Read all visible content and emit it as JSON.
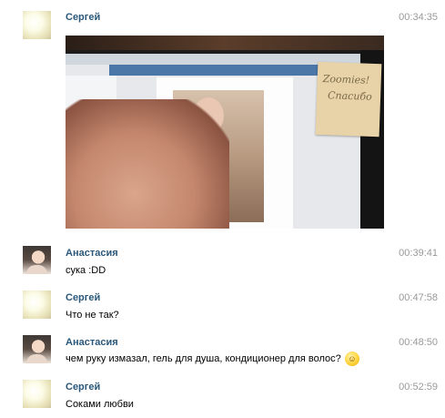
{
  "messages": [
    {
      "author": "Сергей",
      "time": "00:34:35",
      "text": "",
      "avatar": "sergey-avatar"
    },
    {
      "author": "Анастасия",
      "time": "00:39:41",
      "text": "сука :DD",
      "avatar": "anastasia-avatar"
    },
    {
      "author": "Сергей",
      "time": "00:47:58",
      "text": "Что не так?",
      "avatar": "sergey-avatar"
    },
    {
      "author": "Анастасия",
      "time": "00:48:50",
      "text": "чем руку измазал, гель для душа, кондиционер для волос?",
      "emoji": "laughing-emoji",
      "avatar": "anastasia-avatar"
    },
    {
      "author": "Сергей",
      "time": "00:52:59",
      "text": "Соками любви",
      "avatar": "sergey-avatar"
    }
  ],
  "attachment": {
    "note_line1": "Zoomies!",
    "note_line2": "Спасибо"
  },
  "colors": {
    "author": "#2b587a",
    "time": "#999999",
    "text": "#000000",
    "background": "#ffffff"
  }
}
